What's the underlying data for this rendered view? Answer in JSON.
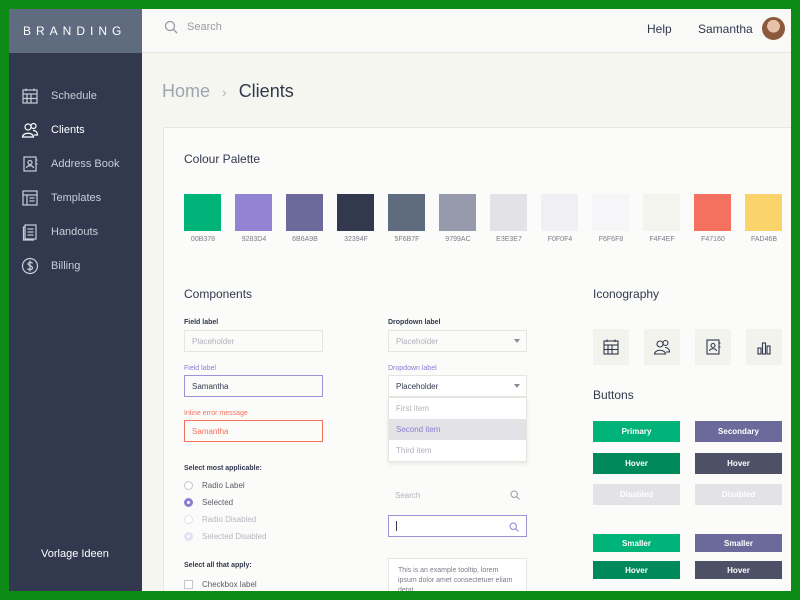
{
  "brand": "BRANDING",
  "nav": [
    {
      "label": "Schedule",
      "icon": "calendar-icon"
    },
    {
      "label": "Clients",
      "icon": "users-icon"
    },
    {
      "label": "Address Book",
      "icon": "address-book-icon"
    },
    {
      "label": "Templates",
      "icon": "templates-icon"
    },
    {
      "label": "Handouts",
      "icon": "handouts-icon"
    },
    {
      "label": "Billing",
      "icon": "dollar-icon"
    }
  ],
  "sidebar_footer": "Vorlage Ideen",
  "topbar": {
    "search_placeholder": "Search",
    "help": "Help",
    "user": "Samantha"
  },
  "breadcrumb": {
    "home": "Home",
    "current": "Clients"
  },
  "palette": {
    "title": "Colour Palette",
    "colors": [
      {
        "hex": "#00B378",
        "label": "00B378"
      },
      {
        "hex": "#9283D4",
        "label": "9283D4"
      },
      {
        "hex": "#6B6A9B",
        "label": "6B6A9B"
      },
      {
        "hex": "#32394F",
        "label": "32394F"
      },
      {
        "hex": "#5F6B7F",
        "label": "5F6B7F"
      },
      {
        "hex": "#9799AC",
        "label": "9799AC"
      },
      {
        "hex": "#E3E3E7",
        "label": "E3E3E7"
      },
      {
        "hex": "#F0F0F4",
        "label": "F0F0F4"
      },
      {
        "hex": "#F6F6F8",
        "label": "F6F6F8"
      },
      {
        "hex": "#F4F4EF",
        "label": "F4F4EF"
      },
      {
        "hex": "#F47160",
        "label": "F47160"
      },
      {
        "hex": "#FAD46B",
        "label": "FAD46B"
      }
    ]
  },
  "components": {
    "title": "Components",
    "field_label": "Field label",
    "placeholder": "Placeholder",
    "field_label_focus": "Field label",
    "value": "Samantha",
    "error_label": "Inline error message",
    "error_value": "Samantha",
    "dropdown_label": "Dropdown label",
    "dropdown_placeholder": "Placeholder",
    "dropdown_label_active": "Dropdown label",
    "dropdown_open_value": "Placeholder",
    "dropdown_options": [
      "First item",
      "Second item",
      "Third item"
    ],
    "radio_title": "Select most applicable:",
    "radios": [
      "Radio Label",
      "Selected",
      "Radio Disabled",
      "Selected Disabled"
    ],
    "checkbox_title": "Select all that apply:",
    "checkbox": "Checkbox label",
    "search_placeholder": "Search",
    "tooltip": "This is an example tooltip, lorem ipsum dolor amet consectetuer eliam detat"
  },
  "iconography": {
    "title": "Iconography",
    "icons": [
      "calendar-icon",
      "users-icon",
      "address-book-icon",
      "bar-chart-icon"
    ]
  },
  "buttons": {
    "title": "Buttons",
    "primary": "Primary",
    "secondary": "Secondary",
    "hover": "Hover",
    "disabled": "Disabled",
    "smaller": "Smaller"
  }
}
